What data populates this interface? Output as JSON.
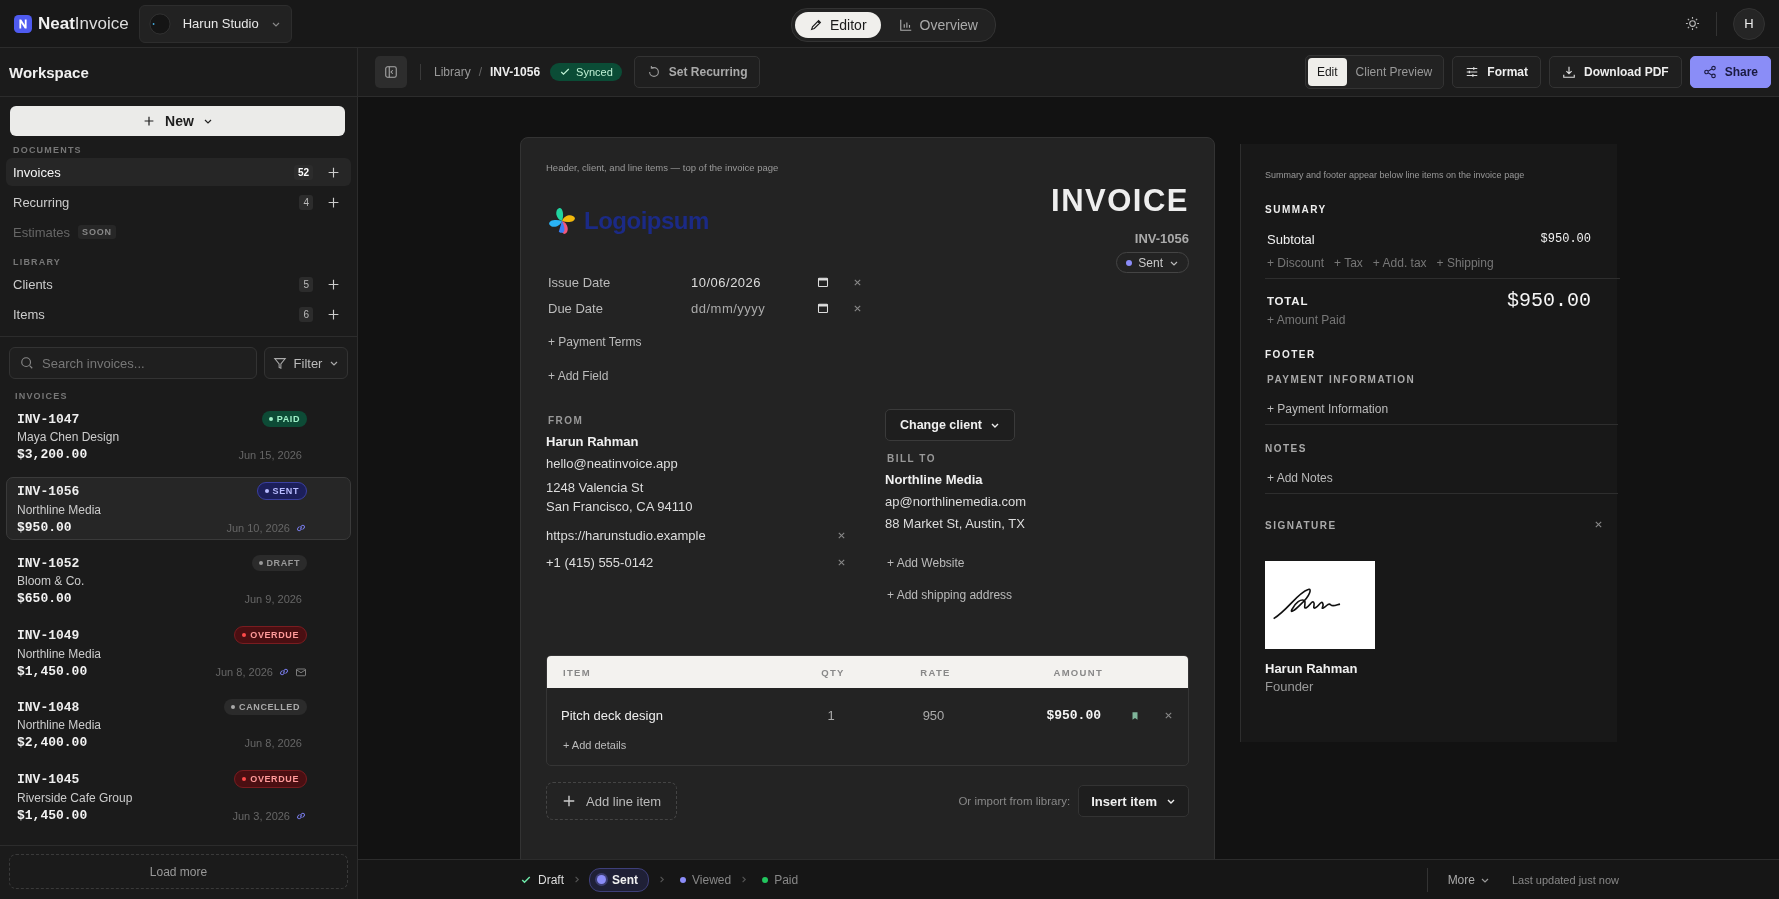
{
  "app": {
    "brand_main": "Neat",
    "brand_rest": "Invoice",
    "workspace": "Harun Studio",
    "avatar": "H"
  },
  "view_tabs": [
    {
      "label": "Editor",
      "selected": true
    },
    {
      "label": "Overview",
      "selected": false
    }
  ],
  "sidebar": {
    "title": "Workspace",
    "new_button": "New",
    "sections": [
      {
        "heading": "DOCUMENTS",
        "items": [
          {
            "label": "Invoices",
            "count": "52",
            "selected": true,
            "disabled": false
          },
          {
            "label": "Recurring",
            "count": "4",
            "selected": false,
            "disabled": false
          },
          {
            "label": "Estimates",
            "badge": "SOON",
            "selected": false,
            "disabled": true
          }
        ]
      },
      {
        "heading": "LIBRARY",
        "items": [
          {
            "label": "Clients",
            "count": "5",
            "selected": false,
            "disabled": false
          },
          {
            "label": "Items",
            "count": "6",
            "selected": false,
            "disabled": false
          }
        ]
      }
    ],
    "search": {
      "placeholder": "Search invoices..."
    },
    "filter": "Filter",
    "list_heading": "INVOICES",
    "invoices": [
      {
        "number": "INV-1047",
        "client": "Maya Chen Design",
        "amount": "$3,200.00",
        "date": "Jun 15, 2026",
        "status": "PAID",
        "kind": "paid",
        "selected": false,
        "link": false,
        "email": false
      },
      {
        "number": "INV-1056",
        "client": "Northline Media",
        "amount": "$950.00",
        "date": "Jun 10, 2026",
        "status": "SENT",
        "kind": "sent",
        "selected": true,
        "link": true,
        "email": false
      },
      {
        "number": "INV-1052",
        "client": "Bloom & Co.",
        "amount": "$650.00",
        "date": "Jun 9, 2026",
        "status": "DRAFT",
        "kind": "draft",
        "selected": false,
        "link": false,
        "email": false
      },
      {
        "number": "INV-1049",
        "client": "Northline Media",
        "amount": "$1,450.00",
        "date": "Jun 8, 2026",
        "status": "OVERDUE",
        "kind": "overdue",
        "selected": false,
        "link": true,
        "email": true
      },
      {
        "number": "INV-1048",
        "client": "Northline Media",
        "amount": "$2,400.00",
        "date": "Jun 8, 2026",
        "status": "CANCELLED",
        "kind": "cancelled",
        "selected": false,
        "link": false,
        "email": false
      },
      {
        "number": "INV-1045",
        "client": "Riverside Cafe Group",
        "amount": "$1,450.00",
        "date": "Jun 3, 2026",
        "status": "OVERDUE",
        "kind": "overdue",
        "selected": false,
        "link": true,
        "email": false
      }
    ],
    "load_more": "Load more"
  },
  "toolbar": {
    "breadcrumb": [
      "Library",
      "INV-1056"
    ],
    "breadcrumb_separator": "/",
    "sync": "Synced",
    "recurring": "Set Recurring",
    "modes": [
      {
        "label": "Edit",
        "selected": true
      },
      {
        "label": "Client Preview",
        "selected": false
      }
    ],
    "format": "Format",
    "download": "Download PDF",
    "share": "Share"
  },
  "invoice": {
    "note": "Header, client, and line items — top of the invoice page",
    "logo": "Logoipsum",
    "title": "INVOICE",
    "number": "INV-1056",
    "status": "Sent",
    "dates": [
      {
        "label": "Issue Date",
        "value": "10/06/2026"
      },
      {
        "label": "Due Date",
        "placeholder": "dd/mm/yyyy"
      }
    ],
    "add_links": [
      "+ Payment Terms",
      "+ Add Field"
    ],
    "from": {
      "heading": "FROM",
      "name": "Harun Rahman",
      "email": "hello@neatinvoice.app",
      "address": [
        "1248 Valencia St",
        "San Francisco, CA 94110"
      ],
      "website": "https://harunstudio.example",
      "phone": "+1 (415) 555-0142"
    },
    "client_button": "Change client",
    "bill_to": {
      "heading": "BILL TO",
      "name": "Northline Media",
      "email": "ap@northlinemedia.com",
      "address": "88 Market St, Austin, TX"
    },
    "client_links": [
      "+ Add Website",
      "+ Add shipping address"
    ],
    "table": {
      "columns": [
        "ITEM",
        "QTY",
        "RATE",
        "AMOUNT"
      ],
      "rows": [
        {
          "item": "Pitch deck design",
          "qty": "1",
          "rate": "950",
          "amount": "$950.00",
          "details": "+ Add details"
        }
      ]
    },
    "add_line": "Add line item",
    "import_label": "Or import from library:",
    "insert": "Insert item"
  },
  "summary": {
    "note": "Summary and footer appear below line items on the invoice page",
    "heading": "SUMMARY",
    "subtotal_label": "Subtotal",
    "subtotal": "$950.00",
    "adds": [
      "+ Discount",
      "+ Tax",
      "+ Add. tax",
      "+ Shipping"
    ],
    "total_label": "TOTAL",
    "total": "$950.00",
    "amount_paid": "+ Amount Paid",
    "footer_heading": "FOOTER",
    "sections": [
      {
        "heading": "PAYMENT INFORMATION",
        "action": "+ Payment Information"
      },
      {
        "heading": "NOTES",
        "action": "+ Add Notes"
      }
    ],
    "signature": {
      "heading": "SIGNATURE",
      "name": "Harun Rahman",
      "role": "Founder"
    }
  },
  "status_bar": {
    "steps": [
      {
        "label": "Draft",
        "kind": "done",
        "color": "#6ee7a8"
      },
      {
        "label": "Sent",
        "kind": "current",
        "color": "#8b8cf8"
      },
      {
        "label": "Viewed",
        "kind": "pending",
        "color": "#8b8cf8"
      },
      {
        "label": "Paid",
        "kind": "pending",
        "color": "#22c55e"
      }
    ],
    "more": "More",
    "updated": "Last updated just now"
  }
}
